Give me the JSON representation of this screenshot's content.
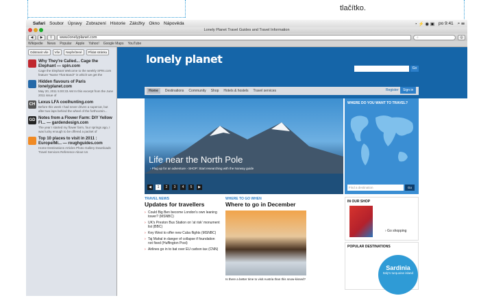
{
  "callout": {
    "text": "tlačítko."
  },
  "menubar": {
    "apple": "",
    "items": [
      "Safari",
      "Soubor",
      "Úpravy",
      "Zobrazení",
      "Historie",
      "Záložky",
      "Okno",
      "Nápověda"
    ],
    "clock": "po 9:41"
  },
  "window": {
    "title": "Lonely Planet Travel Guides and Travel Information"
  },
  "toolbar": {
    "back": "◀",
    "forward": "▶",
    "share": "⇪",
    "url": "www.lonelyplanet.com"
  },
  "bookmarks": [
    "Wikipedie",
    "News",
    "Popular",
    "Apple",
    "Yahoo!",
    "Google Maps",
    "YouTube"
  ],
  "sidebar": {
    "buttons": [
      "Odstranit vše",
      "Vše",
      "Nepřečtené",
      "Přidat stránku"
    ],
    "items": [
      {
        "icon": "spin-icon",
        "color": "#c0272d",
        "title": "Why They're Called... Cage the Elephant — spin.com",
        "desc": "Cage the Elephant Welcome to the weekly SPIN.com feature \"Name That Band!\" in which we get the"
      },
      {
        "icon": "nat-geo-icon",
        "color": "#2469a8",
        "title": "Hidden flavours of Paris lonelyplanet.com",
        "desc": "May 20, 2011 5:00:33 AM In this excerpt from the June 2011 issue of"
      },
      {
        "icon": "ch-icon",
        "color": "#555",
        "glyph": "CH",
        "title": "Lexus LFA coolhunting.com",
        "desc": "Before this week I had never driven a supercar, but after two laps behind the wheel of the forthcomin..."
      },
      {
        "icon": "gd-icon",
        "color": "#222",
        "glyph": "GD",
        "title": "Notes from a Flower Farm: DIY Yellow Fl... — gardendesign.com",
        "desc": "The year I started my flower farm, four springs ago, I was lucky enough to be offered a packet of"
      },
      {
        "icon": "rg-icon",
        "color": "#f08a24",
        "title": "Top 10 places to visit in 2011 : Europe/Mi... — roughguides.com",
        "desc": "Home Destinations Articles Photo Gallery Downloads Travel Services Reference About Us"
      }
    ]
  },
  "page": {
    "logo": "lonely planet",
    "search_go": "Go",
    "nav": [
      "Home",
      "Destinations",
      "Community",
      "Shop",
      "Hotels & hostels",
      "Travel services"
    ],
    "register": "Register",
    "signin": "Sign in",
    "hero": {
      "title": "Life near the North Pole",
      "sub": "›  Plug up for an adventure  ›  SHOP: Start researching with the Norway guide",
      "pages": [
        "◀",
        "1",
        "2",
        "3",
        "4",
        "5",
        "▶"
      ],
      "active_page": "1"
    },
    "map": {
      "title": "WHERE DO YOU WANT TO TRAVEL?",
      "placeholder": "Find a destination",
      "go": "Go"
    },
    "news": {
      "label": "TRAVEL NEWS",
      "title": "Updates for travellers",
      "items": [
        "Could Big Ben become London's own leaning tower? (MSNBC)",
        "UK's Preston Bus Station on 'at risk' monument list (BBC)",
        "Key West to offer new Cuba flights (MSNBC)",
        "Taj Mahal in danger of collapse if foundation not fixed (Huffington Post)",
        "Airlines go in to bat over EU carbon tax (CNN)"
      ]
    },
    "where_to_go": {
      "label": "WHERE TO GO WHEN",
      "title": "Where to go in December",
      "caption": "Is there a better time to visit Austria than this snow-kissed?"
    },
    "shop": {
      "label": "IN OUR SHOP",
      "link": "›  Go shopping"
    },
    "destinations": {
      "label": "POPULAR DESTINATIONS",
      "name": "Sardinia",
      "sub": "Italy's turquoise island"
    }
  }
}
